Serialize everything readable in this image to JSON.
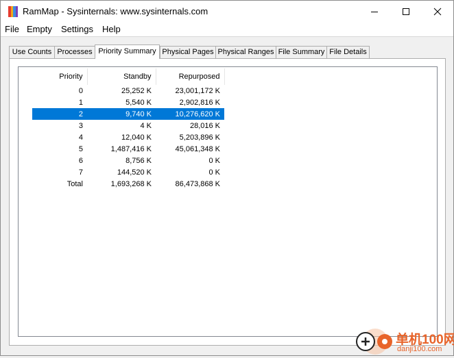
{
  "window": {
    "title": "RamMap - Sysinternals: www.sysinternals.com"
  },
  "menu": [
    "File",
    "Empty",
    "Settings",
    "Help"
  ],
  "tabs": [
    {
      "label": "Use Counts",
      "active": false
    },
    {
      "label": "Processes",
      "active": false
    },
    {
      "label": "Priority Summary",
      "active": true
    },
    {
      "label": "Physical Pages",
      "active": false
    },
    {
      "label": "Physical Ranges",
      "active": false
    },
    {
      "label": "File Summary",
      "active": false
    },
    {
      "label": "File Details",
      "active": false
    }
  ],
  "table": {
    "columns": [
      "Priority",
      "Standby",
      "Repurposed"
    ],
    "rows": [
      [
        "0",
        "25,252 K",
        "23,001,172 K"
      ],
      [
        "1",
        "5,540 K",
        "2,902,816 K"
      ],
      [
        "2",
        "9,740 K",
        "10,276,620 K"
      ],
      [
        "3",
        "4 K",
        "28,016 K"
      ],
      [
        "4",
        "12,040 K",
        "5,203,896 K"
      ],
      [
        "5",
        "1,487,416 K",
        "45,061,348 K"
      ],
      [
        "6",
        "8,756 K",
        "0 K"
      ],
      [
        "7",
        "144,520 K",
        "0 K"
      ],
      [
        "Total",
        "1,693,268 K",
        "86,473,868 K"
      ]
    ],
    "selected_row": 2
  },
  "watermark": {
    "cn": "单机100网",
    "en": "danji100.com"
  },
  "colors": {
    "selection": "#0078d7",
    "watermark": "#e8642a"
  },
  "icons": [
    "rammap-app-icon",
    "minimize-icon",
    "maximize-icon",
    "close-icon",
    "watermark-logo-icon"
  ]
}
